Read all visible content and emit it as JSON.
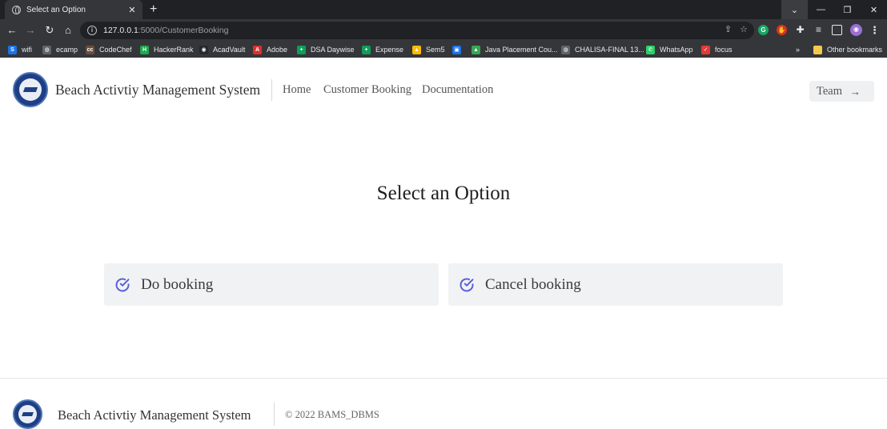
{
  "browser": {
    "tab": {
      "title": "Select an Option",
      "close_glyph": "✕"
    },
    "new_tab_glyph": "+",
    "window_controls": {
      "tab_search": "⌄",
      "minimize": "—",
      "restore": "❐",
      "close": "✕"
    },
    "url_host": "127.0.0.1",
    "url_rest": ":5000/CustomerBooking",
    "bookmarks": [
      {
        "label": "wifi",
        "icon": "s-square-icon",
        "color": "#1a73e8"
      },
      {
        "label": "ecamp",
        "icon": "globe-icon",
        "color": "#5f6368"
      },
      {
        "label": "CodeChef",
        "icon": "codechef-icon",
        "color": "#6b4e3d"
      },
      {
        "label": "HackerRank",
        "icon": "hackerrank-icon",
        "color": "#1ba94c"
      },
      {
        "label": "AcadVault",
        "icon": "github-icon",
        "color": "#24292e"
      },
      {
        "label": "Adobe",
        "icon": "adobe-pdf-icon",
        "color": "#e02f2f"
      },
      {
        "label": "DSA Daywise",
        "icon": "sheets-icon",
        "color": "#0f9d58"
      },
      {
        "label": "Expense",
        "icon": "sheets-icon",
        "color": "#0f9d58"
      },
      {
        "label": "Sem5",
        "icon": "drive-icon",
        "color": "#fbbc04"
      },
      {
        "label": "",
        "icon": "folder-icon",
        "color": "#1a73e8"
      },
      {
        "label": "Java Placement Cou...",
        "icon": "drive-icon",
        "color": "#34a853"
      },
      {
        "label": "CHALISA-FINAL 13...",
        "icon": "globe-icon",
        "color": "#5f6368"
      },
      {
        "label": "WhatsApp",
        "icon": "whatsapp-icon",
        "color": "#25d366"
      },
      {
        "label": "focus",
        "icon": "check-circle-icon",
        "color": "#e53935"
      }
    ],
    "bookmarks_overflow": "»",
    "other_bookmarks": "Other bookmarks"
  },
  "header": {
    "brand": "Beach Activtiy Management System",
    "nav": [
      "Home",
      "Customer Booking",
      "Documentation"
    ],
    "team_button": "Team",
    "team_arrow": "→"
  },
  "main": {
    "title": "Select an Option",
    "options": [
      "Do booking",
      "Cancel booking"
    ],
    "accent_color": "#5a5fd6"
  },
  "footer": {
    "brand": "Beach Activtiy Management System",
    "copyright": "© 2022 BAMS_DBMS"
  }
}
